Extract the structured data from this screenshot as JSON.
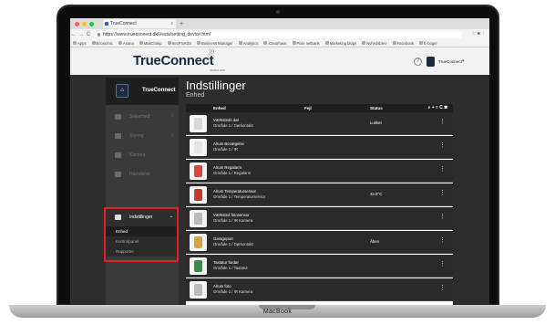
{
  "browser": {
    "tab_title": "TrueConnect",
    "tab_close": "x",
    "new_tab": "+",
    "back": "←",
    "forward": "→",
    "reload": "C",
    "url": "https://www.trueconnect.dk/Vesta/setting_device.html",
    "right_icons": "☆   ■   ⋮",
    "bookmarks": [
      "Apps",
      "Economic",
      "Asana",
      "MailChimp",
      "SecProKitS",
      "Business Manager",
      "Analytics",
      "iClearhaus",
      "Pixie netbank",
      "Marketing blogs",
      "Nyhedsbrev",
      "Facebook",
      "E-boger"
    ]
  },
  "header": {
    "logo": "TrueConnect",
    "logo_sub": "SMART APP",
    "help": "?",
    "user_label": "TrueConnect",
    "user_caret": "▾"
  },
  "sidebar": {
    "title": "TrueConnect",
    "logo_text": "⌂",
    "items": [
      {
        "label": "Sikkerhed",
        "arrow": "›"
      },
      {
        "label": "Styring",
        "arrow": "›"
      },
      {
        "label": "Kamera",
        "arrow": ""
      },
      {
        "label": "Hændelse",
        "arrow": ""
      },
      {
        "label": "Indstillinger",
        "arrow": "⌄"
      }
    ],
    "subitems": [
      "Enhed",
      "Kontrolpanel",
      "Rapporter"
    ]
  },
  "page": {
    "title": "Indstillinger",
    "subtitle": "Enhed"
  },
  "table": {
    "headers": {
      "device": "Enhed",
      "fault": "Fejl",
      "status": "Status"
    },
    "tools": "⌕ + ≈ C ✖",
    "rows": [
      {
        "name": "Værksteds dør",
        "loc": "Område 1 / Dørkontakt",
        "status": "Lukket",
        "thumb": "#d7d7d7"
      },
      {
        "name": "Alrum Bevægelse",
        "loc": "Område 1 / IR",
        "status": "",
        "thumb": "#e5e5e5"
      },
      {
        "name": "Alrum Regalarm",
        "loc": "Område 1 / Regalarm",
        "status": "",
        "thumb": "#d94a3d"
      },
      {
        "name": "Alrum Temperatursensor",
        "loc": "Område 1 / Temperatursensor",
        "status": "22.9°C",
        "thumb": "#c23a2e"
      },
      {
        "name": "Værksted fotosensor",
        "loc": "Område 1 / IR Kamera",
        "status": "",
        "thumb": "#bbbbbb"
      },
      {
        "name": "Garageport",
        "loc": "Område 1 / Dørkontakt",
        "status": "Åben",
        "thumb": "#d9a441"
      },
      {
        "name": "Tastatur fordør",
        "loc": "Område 1 / Tastatur",
        "status": "",
        "thumb": "#3a8a4a"
      },
      {
        "name": "Alrum foto",
        "loc": "Område 1 / IR Kamera",
        "status": "",
        "thumb": "#bbbbbb"
      }
    ]
  },
  "device_label": "MacBook"
}
